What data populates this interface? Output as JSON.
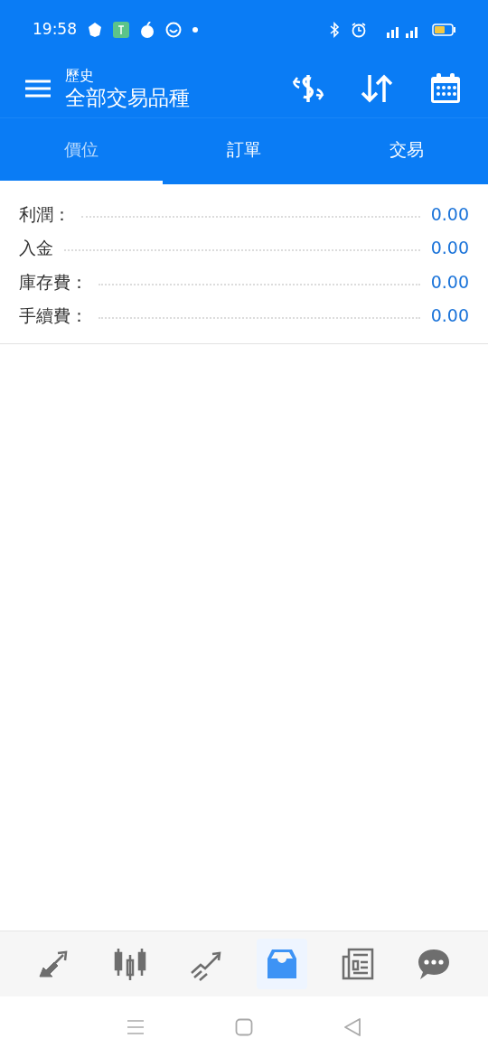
{
  "status_bar": {
    "time": "19:58"
  },
  "header": {
    "subtitle": "歷史",
    "title": "全部交易品種"
  },
  "tabs": [
    {
      "label": "價位",
      "selected": true
    },
    {
      "label": "訂單",
      "selected": false
    },
    {
      "label": "交易",
      "selected": false
    }
  ],
  "summary": [
    {
      "label": "利潤：",
      "value": "0.00"
    },
    {
      "label": "入金",
      "value": "0.00"
    },
    {
      "label": "庫存費：",
      "value": "0.00"
    },
    {
      "label": "手續費：",
      "value": "0.00"
    }
  ],
  "bottom_nav": [
    {
      "kind": "trade",
      "selected": false
    },
    {
      "kind": "chart",
      "selected": false
    },
    {
      "kind": "trend",
      "selected": false
    },
    {
      "kind": "history",
      "selected": true
    },
    {
      "kind": "news",
      "selected": false
    },
    {
      "kind": "chat",
      "selected": false
    }
  ]
}
